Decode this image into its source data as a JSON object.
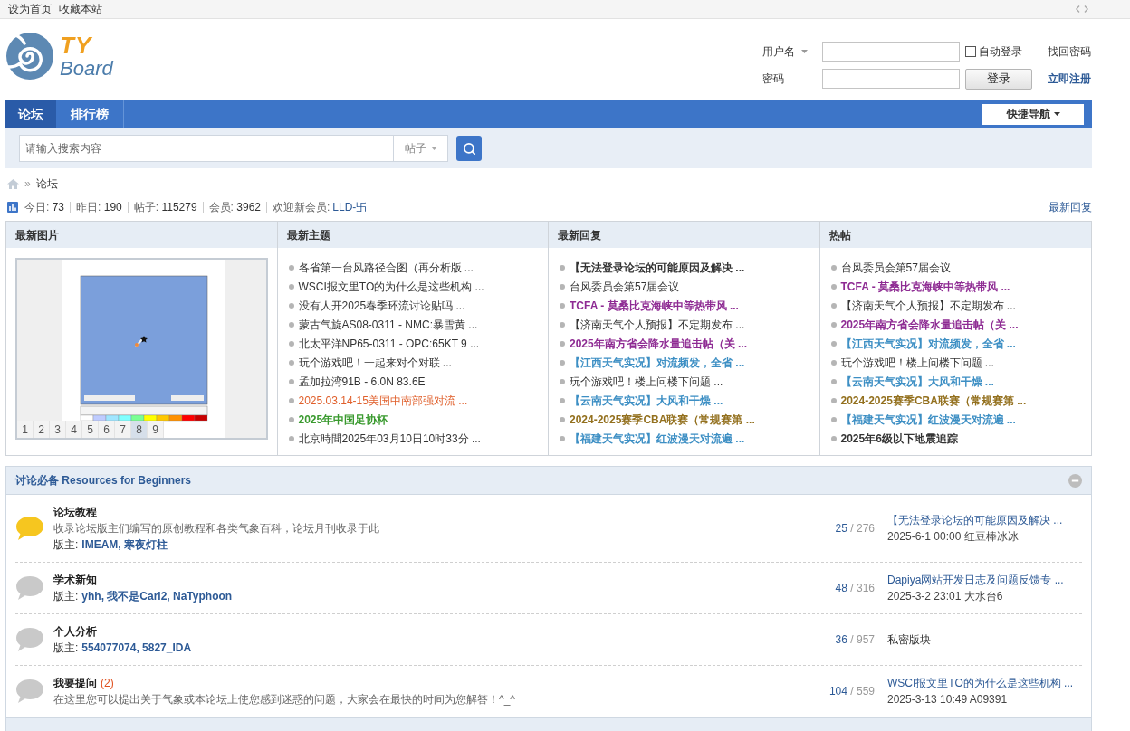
{
  "top_bar": {
    "links": [
      "设为首页",
      "收藏本站"
    ]
  },
  "logo": {
    "primary": "TY",
    "secondary": "Board"
  },
  "login": {
    "username_label": "用户名",
    "password_label": "密码",
    "remember": {
      "label": "自动登录",
      "checked": false
    },
    "submit": "登录",
    "links": [
      {
        "label": "找回密码",
        "bold": false
      },
      {
        "label": "立即注册",
        "bold": true
      }
    ]
  },
  "nav": {
    "tabs": [
      {
        "label": "论坛",
        "selected": true
      },
      {
        "label": "排行榜",
        "selected": false
      }
    ],
    "quick_nav": "快捷导航"
  },
  "search": {
    "placeholder": "请输入搜索内容",
    "type": "帖子"
  },
  "breadcrumb": {
    "separator": "»",
    "current": "论坛"
  },
  "stats": {
    "items": [
      {
        "label": "今日:",
        "value": "73"
      },
      {
        "label": "昨日:",
        "value": "190"
      },
      {
        "label": "帖子:",
        "value": "115279"
      },
      {
        "label": "会员:",
        "value": "3962"
      }
    ],
    "new_member": {
      "label": "欢迎新会员:",
      "name": "LLD-卐"
    },
    "latest_link": "最新回复"
  },
  "portal": {
    "columns": [
      {
        "title": "最新图片",
        "kind": "gallery",
        "pages": [
          {
            "label": "1",
            "selected": false
          },
          {
            "label": "2",
            "selected": false
          },
          {
            "label": "3",
            "selected": false
          },
          {
            "label": "4",
            "selected": false
          },
          {
            "label": "5",
            "selected": false
          },
          {
            "label": "6",
            "selected": false
          },
          {
            "label": "7",
            "selected": false
          },
          {
            "label": "8",
            "selected": true
          },
          {
            "label": "9",
            "selected": false
          }
        ]
      },
      {
        "title": "最新主题",
        "kind": "list",
        "items": [
          {
            "text": "各省第一台风路径合图（再分析版 ...",
            "color": "#333333",
            "bold": false
          },
          {
            "text": "WSCI报文里TO的为什么是这些机构 ...",
            "color": "#333333",
            "bold": false
          },
          {
            "text": "没有人开2025春季环流讨论贴吗 ...",
            "color": "#333333",
            "bold": false
          },
          {
            "text": "蒙古气旋AS08-0311 - NMC:暴雪黄 ...",
            "color": "#333333",
            "bold": false
          },
          {
            "text": "北太平洋NP65-0311 - OPC:65KT 9 ...",
            "color": "#333333",
            "bold": false
          },
          {
            "text": "玩个游戏吧！一起来对个对联 ...",
            "color": "#333333",
            "bold": false
          },
          {
            "text": "孟加拉湾91B - 6.0N 83.6E",
            "color": "#333333",
            "bold": false
          },
          {
            "text": "2025.03.14-15美国中南部强对流 ...",
            "color": "#e0602c",
            "bold": false
          },
          {
            "text": "2025年中国足协杯",
            "color": "#3a9a2f",
            "bold": true
          },
          {
            "text": "北京時間2025年03月10日10时33分 ...",
            "color": "#333333",
            "bold": false
          }
        ]
      },
      {
        "title": "最新回复",
        "kind": "list",
        "items": [
          {
            "text": "【无法登录论坛的可能原因及解决 ...",
            "color": "#333333",
            "bold": true
          },
          {
            "text": "台风委员会第57届会议",
            "color": "#333333",
            "bold": false
          },
          {
            "text": "TCFA - 莫桑比克海峡中等热带风 ...",
            "color": "#8e2b93",
            "bold": true
          },
          {
            "text": "【济南天气个人预报】不定期发布 ...",
            "color": "#333333",
            "bold": false
          },
          {
            "text": "2025年南方省会降水量追击帖（关 ...",
            "color": "#8e2b93",
            "bold": true
          },
          {
            "text": "【江西天气实况】对流频发，全省 ...",
            "color": "#3d8fc4",
            "bold": true
          },
          {
            "text": "玩个游戏吧！楼上问楼下问题 ...",
            "color": "#333333",
            "bold": false
          },
          {
            "text": "【云南天气实况】大风和干燥 ...",
            "color": "#3d8fc4",
            "bold": true
          },
          {
            "text": "2024-2025赛季CBA联赛（常规赛第 ...",
            "color": "#93701e",
            "bold": true
          },
          {
            "text": "【福建天气实况】红波漫天对流遍 ...",
            "color": "#3d8fc4",
            "bold": true
          }
        ]
      },
      {
        "title": "热帖",
        "kind": "list",
        "items": [
          {
            "text": "台风委员会第57届会议",
            "color": "#333333",
            "bold": false
          },
          {
            "text": "TCFA - 莫桑比克海峡中等热带风 ...",
            "color": "#8e2b93",
            "bold": true
          },
          {
            "text": "【济南天气个人预报】不定期发布 ...",
            "color": "#333333",
            "bold": false
          },
          {
            "text": "2025年南方省会降水量追击帖（关 ...",
            "color": "#8e2b93",
            "bold": true
          },
          {
            "text": "【江西天气实况】对流频发，全省 ...",
            "color": "#3d8fc4",
            "bold": true
          },
          {
            "text": "玩个游戏吧！楼上问楼下问题 ...",
            "color": "#333333",
            "bold": false
          },
          {
            "text": "【云南天气实况】大风和干燥 ...",
            "color": "#3d8fc4",
            "bold": true
          },
          {
            "text": "2024-2025赛季CBA联赛（常规赛第 ...",
            "color": "#93701e",
            "bold": true
          },
          {
            "text": "【福建天气实况】红波漫天对流遍 ...",
            "color": "#3d8fc4",
            "bold": true
          },
          {
            "text": "2025年6级以下地震追踪",
            "color": "#333333",
            "bold": true
          }
        ]
      }
    ]
  },
  "forum_section": {
    "title": "讨论必备 Resources for Beginners",
    "expanded": true,
    "forums": [
      {
        "name": "论坛教程",
        "has_new": true,
        "description": "收录论坛版主们编写的原创教程和各类气象百科，论坛月刊收录于此",
        "moderator_label": "版主:",
        "moderators": "IMEAM, 寒夜灯柱",
        "threads": "25",
        "posts": "/ 276",
        "last_post": {
          "kind": "post",
          "title": "【无法登录论坛的可能原因及解决 ...",
          "meta": "2025-6-1 00:00 红豆棒冰冰"
        }
      },
      {
        "name": "学术新知",
        "has_new": false,
        "moderator_label": "版主:",
        "moderators": "yhh, 我不是Carl2, NaTyphoon",
        "threads": "48",
        "posts": "/ 316",
        "last_post": {
          "kind": "post",
          "title": "Dapiya网站开发日志及问题反馈专 ...",
          "meta": "2025-3-2 23:01 大水台6"
        }
      },
      {
        "name": "个人分析",
        "has_new": false,
        "moderator_label": "版主:",
        "moderators": "554077074, 5827_IDA",
        "threads": "36",
        "posts": "/ 957",
        "last_post": {
          "kind": "note",
          "text": "私密版块"
        }
      },
      {
        "name": "我要提问",
        "today": "(2)",
        "has_new": false,
        "description": "在这里您可以提出关于气象或本论坛上使您感到迷惑的问题，大家会在最快的时间为您解答！^_^",
        "threads": "104",
        "posts": "/ 559",
        "last_post": {
          "kind": "post",
          "title": "WSCI报文里TO的为什么是这些机构 ...",
          "meta": "2025-3-13 10:49 A09391"
        }
      }
    ]
  }
}
